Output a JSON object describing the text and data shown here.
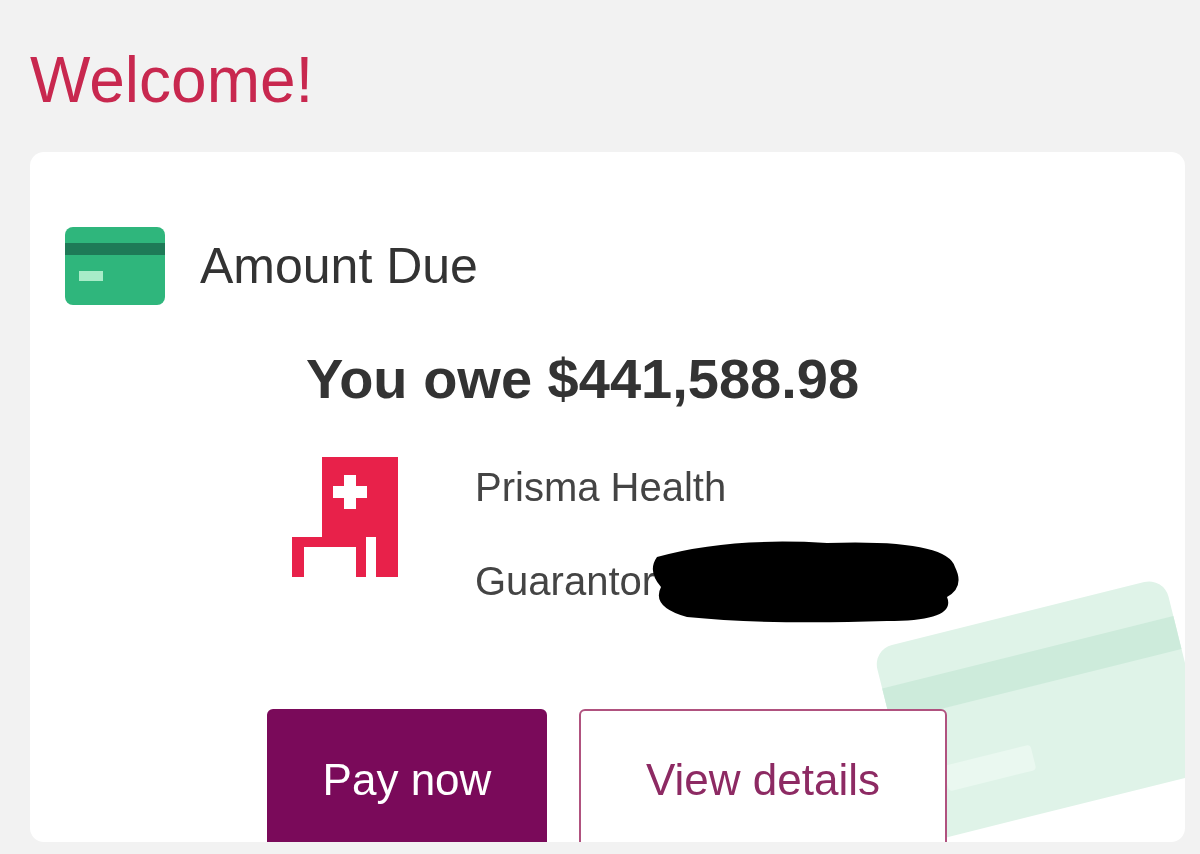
{
  "heading": "Welcome!",
  "card": {
    "title": "Amount Due",
    "amount": "You owe $441,588.98",
    "provider": "Prisma Health",
    "account_label": "Guarantor",
    "buttons": [
      {
        "label": "Pay now",
        "kind": "primary"
      },
      {
        "label": "View details",
        "kind": "secondary"
      }
    ]
  }
}
